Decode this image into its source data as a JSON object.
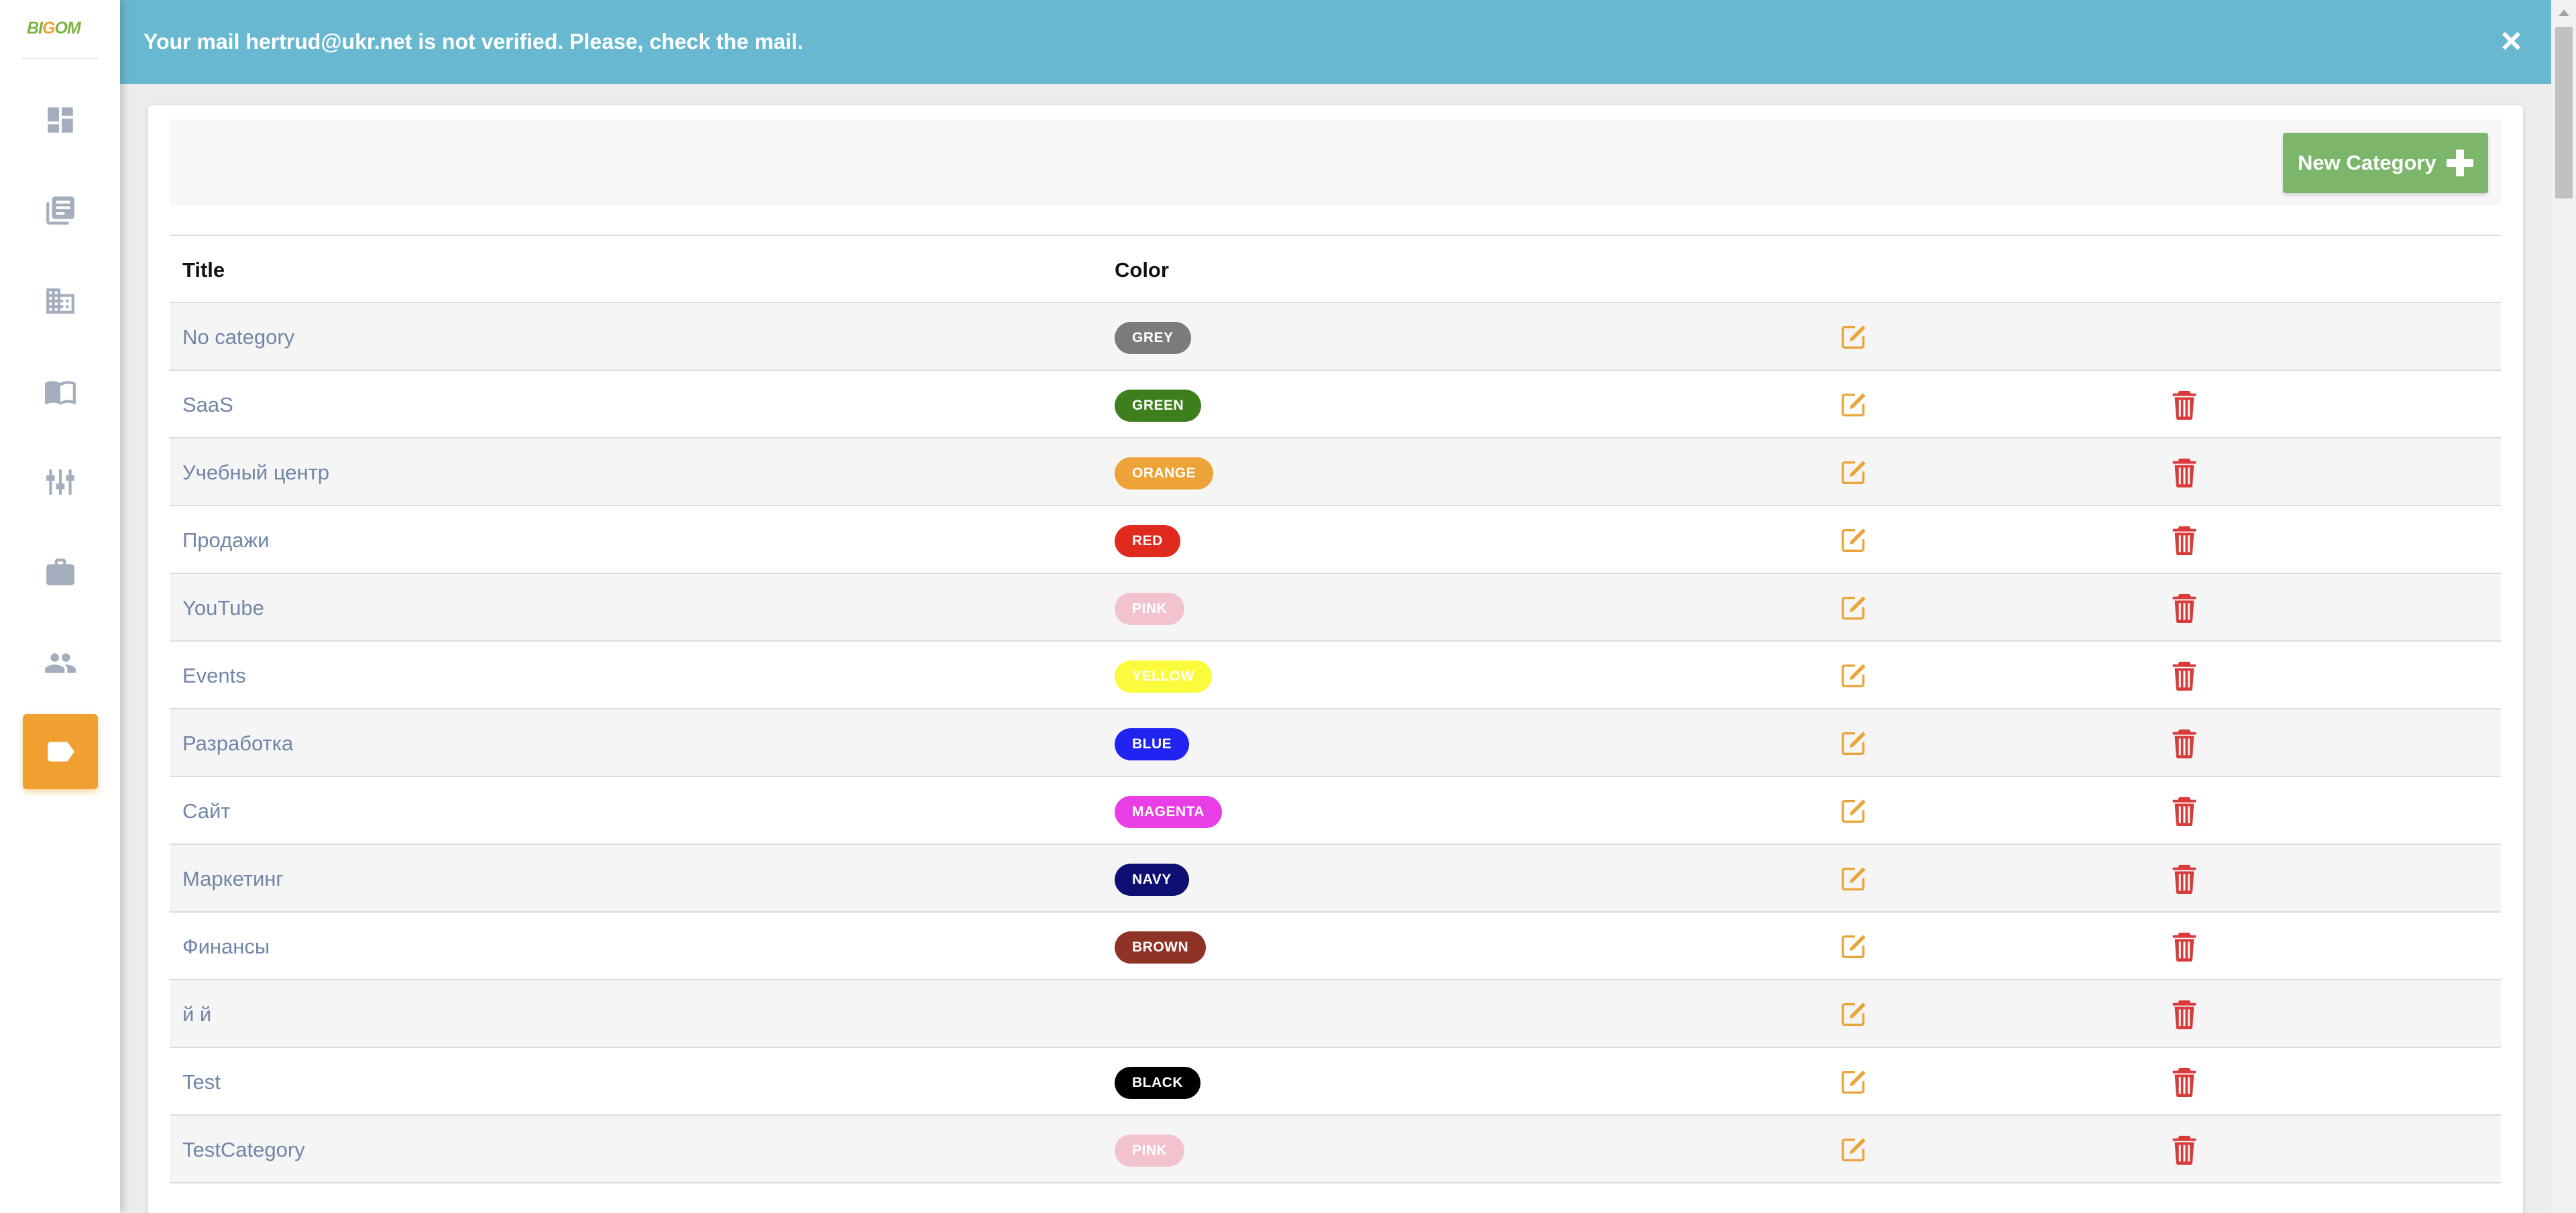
{
  "logo": {
    "text_a": "BI",
    "text_b": "G",
    "text_c": "OM"
  },
  "sidebar": {
    "items": [
      {
        "name": "dashboard-icon"
      },
      {
        "name": "articles-icon"
      },
      {
        "name": "organization-icon"
      },
      {
        "name": "book-icon"
      },
      {
        "name": "settings-sliders-icon"
      },
      {
        "name": "briefcase-icon"
      },
      {
        "name": "people-icon"
      },
      {
        "name": "tag-icon",
        "active": true
      }
    ]
  },
  "alert": {
    "message": "Your mail hertrud@ukr.net is not verified. Please, check the mail.",
    "close_label": "×"
  },
  "toolbar": {
    "new_category_label": "New Category"
  },
  "table": {
    "headers": {
      "title": "Title",
      "color": "Color"
    },
    "rows": [
      {
        "title": "No category",
        "color_label": "GREY",
        "color_hex": "#7b7b7b",
        "deletable": false
      },
      {
        "title": "SaaS",
        "color_label": "GREEN",
        "color_hex": "#3f7e1c",
        "deletable": true
      },
      {
        "title": "Учебный центр",
        "color_label": "ORANGE",
        "color_hex": "#eda338",
        "deletable": true
      },
      {
        "title": "Продажи",
        "color_label": "RED",
        "color_hex": "#e02a1d",
        "deletable": true
      },
      {
        "title": "YouTube",
        "color_label": "PINK",
        "color_hex": "#f2c3cf",
        "deletable": true
      },
      {
        "title": "Events",
        "color_label": "YELLOW",
        "color_hex": "#fbfb3e",
        "deletable": true
      },
      {
        "title": "Разработка",
        "color_label": "BLUE",
        "color_hex": "#2123f0",
        "deletable": true
      },
      {
        "title": "Сайт",
        "color_label": "MAGENTA",
        "color_hex": "#e93ee6",
        "deletable": true
      },
      {
        "title": "Маркетинг",
        "color_label": "NAVY",
        "color_hex": "#0e0f72",
        "deletable": true
      },
      {
        "title": "Финансы",
        "color_label": "BROWN",
        "color_hex": "#8e3326",
        "deletable": true
      },
      {
        "title": "й й",
        "color_label": "",
        "color_hex": "",
        "deletable": true
      },
      {
        "title": "Test",
        "color_label": "BLACK",
        "color_hex": "#000000",
        "deletable": true
      },
      {
        "title": "TestCategory",
        "color_label": "PINK",
        "color_hex": "#f2c3cf",
        "deletable": true
      }
    ]
  },
  "colors": {
    "accent": "#f0a030",
    "alert_bg": "#68b8d1",
    "button_green": "#7cb66a",
    "edit_icon": "#e8a53a",
    "delete_icon": "#d93a3a",
    "title_link": "#7185a8"
  }
}
